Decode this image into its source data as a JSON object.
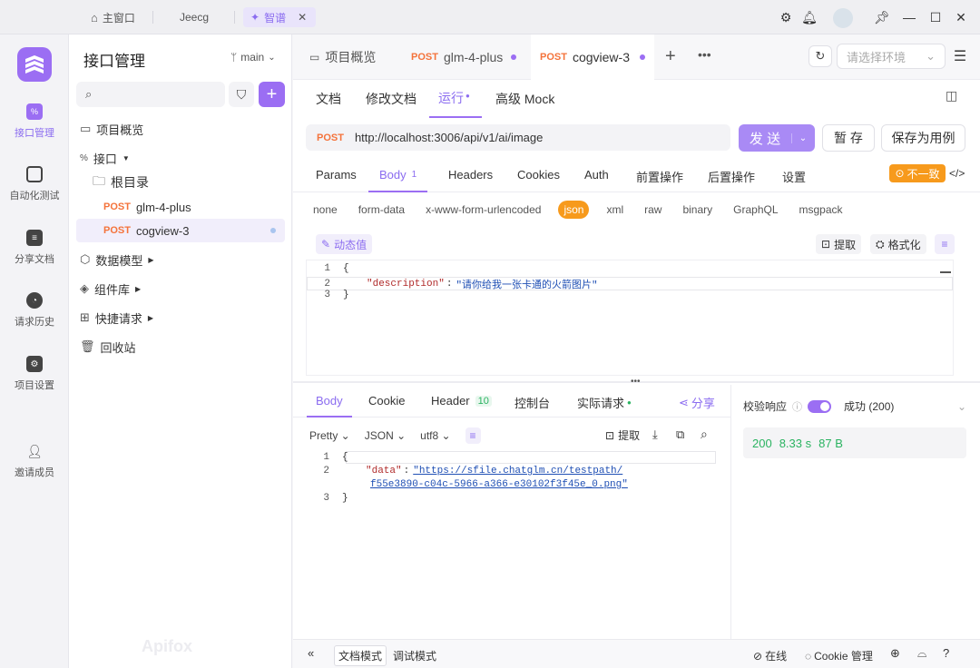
{
  "window": {
    "tabs": [
      {
        "label": "主窗口"
      },
      {
        "label": "Jeecg"
      },
      {
        "label": "智谱"
      }
    ]
  },
  "rail": {
    "items": [
      {
        "label": "接口管理"
      },
      {
        "label": "自动化测试"
      },
      {
        "label": "分享文档"
      },
      {
        "label": "请求历史"
      },
      {
        "label": "项目设置"
      },
      {
        "label": "邀请成员"
      }
    ]
  },
  "sidebar": {
    "title": "接口管理",
    "branch": "main",
    "tree": {
      "overview": "项目概览",
      "api": "接口",
      "root": "根目录",
      "ep1_method": "POST",
      "ep1_name": "glm-4-plus",
      "ep2_method": "POST",
      "ep2_name": "cogview-3",
      "models": "数据模型",
      "components": "组件库",
      "quick": "快捷请求",
      "trash": "回收站"
    },
    "watermark": "Apifox"
  },
  "main": {
    "tabs": [
      {
        "label": "项目概览"
      },
      {
        "method": "POST",
        "label": "glm-4-plus"
      },
      {
        "method": "POST",
        "label": "cogview-3"
      }
    ],
    "env_placeholder": "请选择环境",
    "subtabs": {
      "doc": "文档",
      "edit": "修改文档",
      "run": "运行",
      "mock": "高级 Mock"
    },
    "request": {
      "method": "POST",
      "url": "http://localhost:3006/api/v1/ai/image",
      "send": "发 送",
      "save": "暂 存",
      "save_case": "保存为用例"
    },
    "req_tabs": {
      "params": "Params",
      "body": "Body",
      "body_count": "1",
      "headers": "Headers",
      "cookies": "Cookies",
      "auth": "Auth",
      "pre": "前置操作",
      "post": "后置操作",
      "settings": "设置",
      "mismatch": "不一致"
    },
    "body_types": [
      "none",
      "form-data",
      "x-www-form-urlencoded",
      "json",
      "xml",
      "raw",
      "binary",
      "GraphQL",
      "msgpack"
    ],
    "dynamic_value": "动态值",
    "extract": "提取",
    "format": "格式化",
    "req_code": {
      "l1": "{",
      "key": "\"description\"",
      "value": "\"请你给我一张卡通的火箭图片\"",
      "l3": "}"
    },
    "resp_tabs": {
      "body": "Body",
      "cookie": "Cookie",
      "header": "Header",
      "header_count": "10",
      "console": "控制台",
      "actual": "实际请求",
      "share": "分享"
    },
    "resp_opts": {
      "pretty": "Pretty",
      "json": "JSON",
      "utf8": "utf8",
      "extract": "提取"
    },
    "resp_code": {
      "l1": "{",
      "key": "\"data\"",
      "value1": "\"https://sfile.chatglm.cn/testpath/",
      "value2": "f55e3890-c04c-5966-a366-e30102f3f45e_0.png\"",
      "l3": "}"
    },
    "validate": {
      "label": "校验响应",
      "result": "成功 (200)"
    },
    "metrics": {
      "status": "200",
      "time": "8.33 s",
      "size": "87 B"
    },
    "status_bar": {
      "doc_mode": "文档模式",
      "debug_mode": "调试模式",
      "online": "在线",
      "cookie": "Cookie 管理"
    }
  },
  "colors": {
    "accent": "#9b6ef3",
    "post": "#f4733b",
    "warn": "#f79a1c"
  }
}
